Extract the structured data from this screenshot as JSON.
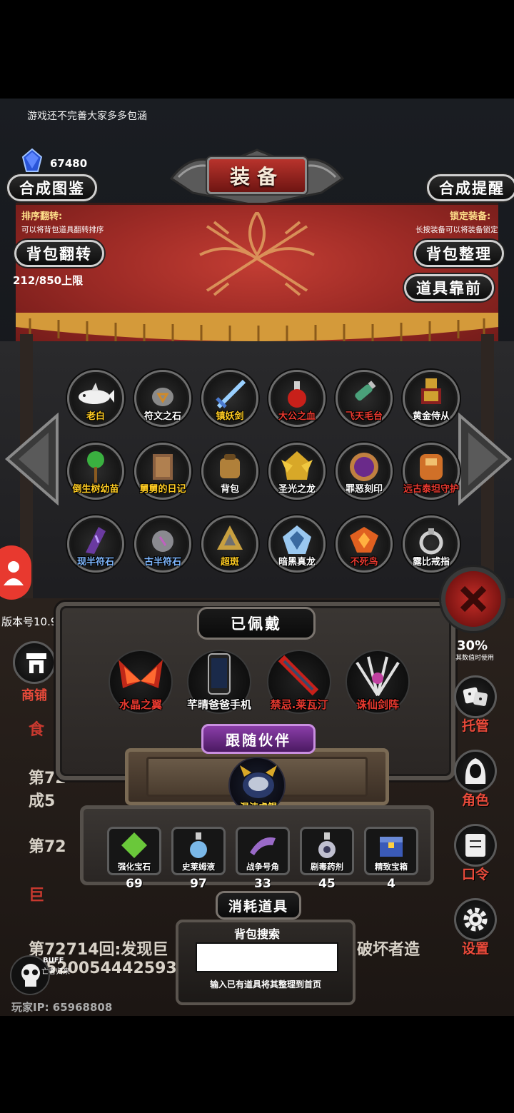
{
  "notice": "游戏还不完善大家多多包涵",
  "currency": {
    "icon": "blue-crystal-icon",
    "amount": "67480"
  },
  "header": {
    "title": "装备"
  },
  "buttons": {
    "synth_catalog": "合成图鉴",
    "synth_reminder": "合成提醒",
    "bag_flip": "背包翻转",
    "bag_sort": "背包整理",
    "item_front": "道具靠前"
  },
  "hints": {
    "left_title": "排序翻转:",
    "left_sub": "可以将背包道具翻转排序",
    "right_title": "锁定装备:",
    "right_sub": "长按装备可以将装备锁定"
  },
  "capacity": "212/850上限",
  "items": [
    {
      "name": "老白",
      "color": "#ffcc22",
      "icon": "white-dolphin-icon"
    },
    {
      "name": "符文之石",
      "color": "#ffffff",
      "icon": "rune-stone-icon"
    },
    {
      "name": "镇妖剑",
      "color": "#ffcc22",
      "icon": "blue-sword-icon"
    },
    {
      "name": "大公之血",
      "color": "#e8392f",
      "icon": "red-potion-icon"
    },
    {
      "name": "飞天毛台",
      "color": "#e8392f",
      "icon": "green-bottle-icon"
    },
    {
      "name": "黄金侍从",
      "color": "#ffffff",
      "icon": "golden-knight-icon"
    },
    {
      "name": "倒生树幼苗",
      "color": "#ffcc22",
      "icon": "green-sapling-icon"
    },
    {
      "name": "舅舅的日记",
      "color": "#ffcc22",
      "icon": "diary-icon"
    },
    {
      "name": "背包",
      "color": "#ffffff",
      "icon": "backpack-icon"
    },
    {
      "name": "圣光之龙",
      "color": "#ffffff",
      "icon": "golden-dragon-icon"
    },
    {
      "name": "罪恶刻印",
      "color": "#ffffff",
      "icon": "purple-seal-icon"
    },
    {
      "name": "远古泰坦守护",
      "color": "#e8392f",
      "icon": "titan-guardian-icon"
    },
    {
      "name": "现半符石",
      "color": "#7fb8ff",
      "icon": "purple-rune-icon"
    },
    {
      "name": "古半符石",
      "color": "#7fb8ff",
      "icon": "gray-rune-icon"
    },
    {
      "name": "超斑",
      "color": "#ffcc22",
      "icon": "gold-beast-icon"
    },
    {
      "name": "暗黑真龙",
      "color": "#ffffff",
      "icon": "ice-dragon-icon"
    },
    {
      "name": "不死鸟",
      "color": "#e8392f",
      "icon": "phoenix-icon"
    },
    {
      "name": "露比戒指",
      "color": "#ffffff",
      "icon": "silver-ring-icon"
    }
  ],
  "equipped": {
    "title": "已佩戴",
    "items": [
      {
        "name": "水晶之翼",
        "color": "#e8392f",
        "icon": "crystal-wings-icon"
      },
      {
        "name": "芊晴爸爸手机",
        "color": "#ffffff",
        "icon": "phone-icon"
      },
      {
        "name": "禁忌.莱瓦汀",
        "color": "#e8392f",
        "icon": "flame-sword-icon"
      },
      {
        "name": "诛仙剑阵",
        "color": "#e8392f",
        "icon": "sword-array-icon"
      }
    ]
  },
  "companion": {
    "title": "跟随伙伴",
    "name": "混沌虚鲲",
    "icon": "chaos-beast-icon"
  },
  "consumables": {
    "title": "消耗道具",
    "items": [
      {
        "name": "强化宝石",
        "count": "69",
        "icon": "green-gem-icon"
      },
      {
        "name": "史莱姆液",
        "count": "97",
        "icon": "slime-flask-icon"
      },
      {
        "name": "战争号角",
        "count": "33",
        "icon": "war-horn-icon"
      },
      {
        "name": "剧毒药剂",
        "count": "45",
        "icon": "poison-flask-icon"
      },
      {
        "name": "精致宝箱",
        "count": "4",
        "icon": "treasure-chest-icon"
      }
    ]
  },
  "search": {
    "label": "背包搜索",
    "placeholder": "",
    "hint": "输入已有道具将其整理到首页"
  },
  "side": {
    "version": "版本号10.9",
    "shop": "商铺",
    "dice": "托管",
    "role": "角色",
    "command": "口令",
    "settings": "设置",
    "partial_number": "30%",
    "partial_sub": "其数值时使用"
  },
  "log": {
    "line1": "食",
    "line2": "第72",
    "line3": "成5",
    "line4": "第72",
    "line5": "巨",
    "line6": "第72714回:发现巨",
    "line6b": "破坏者造",
    "line7": "5200544425933"
  },
  "buff": {
    "label": "BUFF",
    "sub": "亡者归来"
  },
  "player_ip": "玩家IP: 65968808"
}
